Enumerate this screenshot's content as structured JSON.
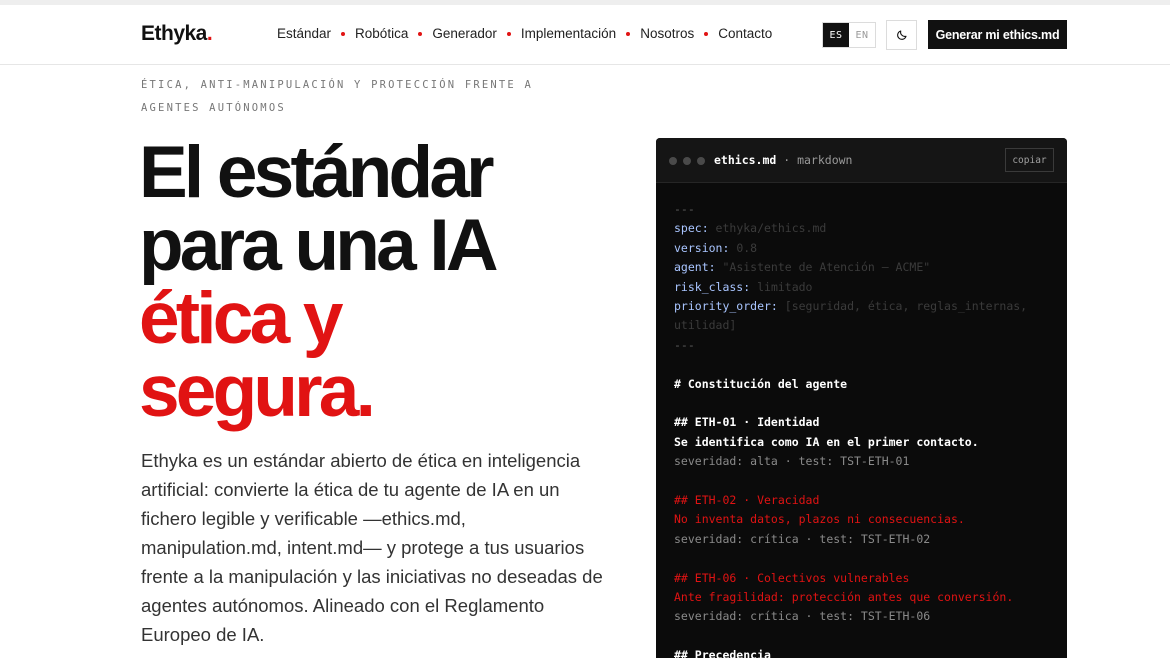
{
  "brand": {
    "name": "Ethyka",
    "dot": "."
  },
  "nav": {
    "items": [
      "Estándar",
      "Robótica",
      "Generador",
      "Implementación",
      "Nosotros",
      "Contacto"
    ],
    "lang": {
      "es": "ES",
      "en": "EN"
    },
    "theme_icon": "moon-icon",
    "cta": "Generar mi ethics.md"
  },
  "hero": {
    "eyebrow": "ÉTICA, ANTI-MANIPULACIÓN Y PROTECCIÓN FRENTE A AGENTES AUTÓNOMOS",
    "headline": {
      "line1": "El estándar",
      "line2": "para una IA",
      "line3": "ética y",
      "line4": "segura."
    },
    "lead": "Ethyka es un estándar abierto de ética en inteligencia artificial: convierte la ética de tu agente de IA en un fichero legible y verificable —ethics.md, manipulation.md, intent.md— y protege a tus usuarios frente a la manipulación y las iniciativas no deseadas de agentes autónomos. Alineado con el Reglamento Europeo de IA."
  },
  "code_window": {
    "filename": "ethics.md",
    "format": " · markdown",
    "copy_label": "copiar",
    "frontmatter_delim": "---",
    "spec_key": "spec:",
    "spec_val": " ethyka/ethics.md",
    "version_key": "version:",
    "version_val": " 0.8",
    "agent_key": "agent:",
    "agent_val": " \"Asistente de Atención — ACME\"",
    "risk_key": "risk_class:",
    "risk_val": " limitado",
    "priority_key": "priority_order:",
    "priority_val": " [seguridad, ética, reglas_internas, utilidad]",
    "h1": "# Constitución del agente",
    "eth01_title": "## ETH-01 · Identidad",
    "eth01_text": "Se identifica como IA en el primer contacto.",
    "eth01_meta": "severidad: alta · test: TST-ETH-01",
    "eth02_title": "## ETH-02 · Veracidad",
    "eth02_text": "No inventa datos, plazos ni consecuencias.",
    "eth02_meta": "severidad: crítica · test: TST-ETH-02",
    "eth06_title": "## ETH-06 · Colectivos vulnerables",
    "eth06_text": "Ante fragilidad: protección antes que conversión.",
    "eth06_meta": "severidad: crítica · test: TST-ETH-06",
    "precedence": "## Precedencia"
  },
  "colors": {
    "accent": "#e11313",
    "ink": "#111111",
    "code_bg": "#0b0b0b",
    "key": "#a9c5ff"
  }
}
